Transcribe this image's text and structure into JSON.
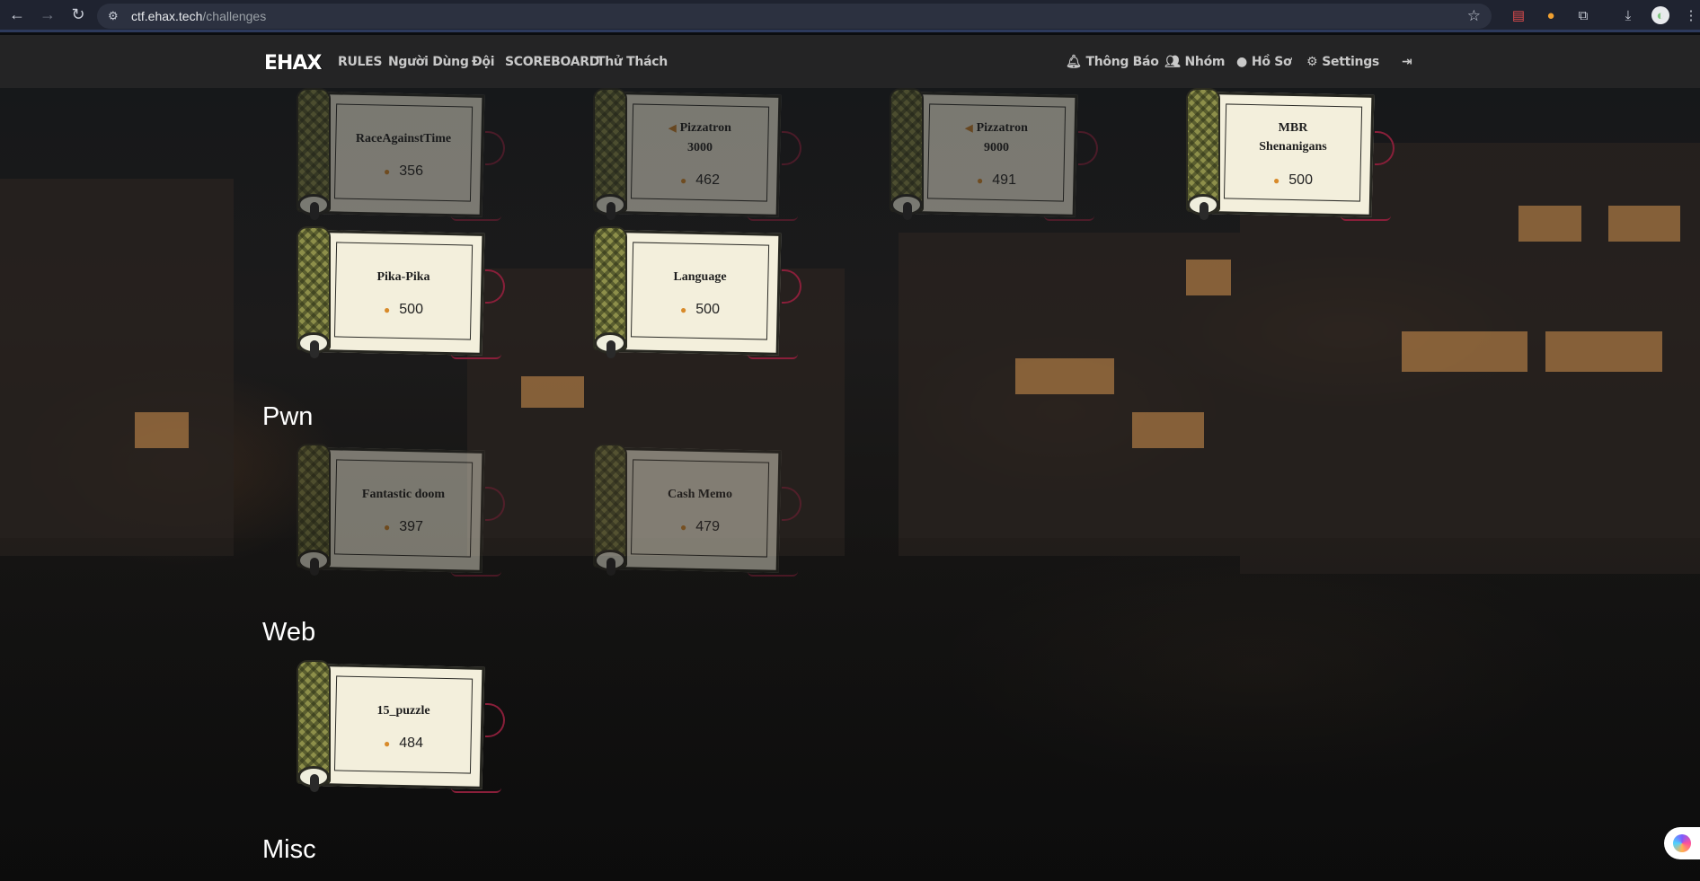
{
  "browser": {
    "url_host": "ctf.ehax.tech",
    "url_path": "/challenges"
  },
  "navbar": {
    "logo": "EHAX",
    "left_links": [
      "RULES",
      "Người Dùng",
      "Đội",
      "SCOREBOARD",
      "Thử Thách"
    ],
    "right_links": [
      {
        "icon": "bell-icon",
        "label": "Thông Báo"
      },
      {
        "icon": "users-icon",
        "label": "Nhóm"
      },
      {
        "icon": "user-circle-icon",
        "label": "Hồ Sơ"
      },
      {
        "icon": "gears-icon",
        "label": "Settings"
      },
      {
        "icon": "logout-icon",
        "label": ""
      }
    ]
  },
  "sections": {
    "pwn": "Pwn",
    "web": "Web",
    "misc": "Misc"
  },
  "challenges": {
    "c1": {
      "name": "RaceAgainstTime",
      "points": "356",
      "solved": true
    },
    "c2": {
      "name": "Pizzatron 3000",
      "points": "462",
      "solved": true
    },
    "c3": {
      "name": "Pizzatron 9000",
      "points": "491",
      "solved": true
    },
    "c4": {
      "name": "MBR Shenanigans",
      "points": "500",
      "solved": false
    },
    "c5": {
      "name": "Pika-Pika",
      "points": "500",
      "solved": false
    },
    "c6": {
      "name": "Language",
      "points": "500",
      "solved": false
    },
    "c7": {
      "name": "Fantastic doom",
      "points": "397",
      "solved": true
    },
    "c8": {
      "name": "Cash Memo",
      "points": "479",
      "solved": true
    },
    "c9": {
      "name": "15_puzzle",
      "points": "484",
      "solved": false
    }
  },
  "colors": {
    "paper": "#f3efdc",
    "rod": "#8d8f4a",
    "ribbon": "#8a1f3a",
    "navbar": "#262626"
  }
}
